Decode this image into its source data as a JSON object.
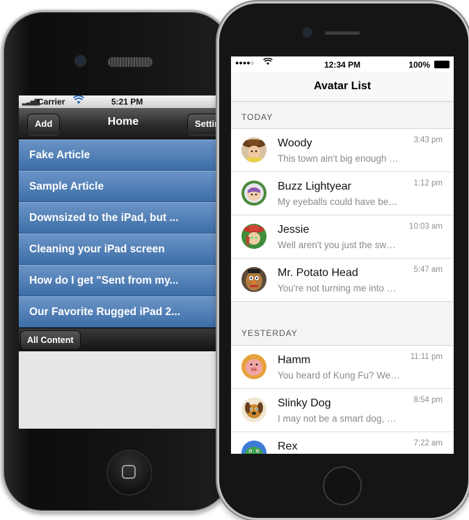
{
  "old_phone": {
    "status": {
      "carrier": "Carrier",
      "time": "5:21 PM"
    },
    "nav": {
      "left_button": "Add",
      "title": "Home",
      "right_button": "Settings"
    },
    "articles": [
      "Fake Article",
      "Sample Article",
      "Downsized to the iPad, but ...",
      "Cleaning your iPad screen",
      "How do I get \"Sent from my...",
      "Our Favorite Rugged iPad 2..."
    ],
    "toolbar": {
      "button": "All Content"
    }
  },
  "new_phone": {
    "status": {
      "time": "12:34 PM",
      "battery": "100%"
    },
    "nav": {
      "title": "Avatar List"
    },
    "sections": [
      {
        "header": "TODAY",
        "items": [
          {
            "name": "Woody",
            "message": "This town ain't big enough for the two of us",
            "time": "3:43 pm",
            "avatar_color": "#b5763a",
            "avatar_icon": "cowboy-avatar-icon"
          },
          {
            "name": "Buzz Lightyear",
            "message": "My eyeballs could have been sucked from their sockets",
            "time": "1:12 pm",
            "avatar_color": "#7a4fa8",
            "avatar_icon": "astronaut-avatar-icon"
          },
          {
            "name": "Jessie",
            "message": "Well aren't you just the sweetest",
            "time": "10:03 am",
            "avatar_color": "#c0392b",
            "avatar_icon": "cowgirl-avatar-icon"
          },
          {
            "name": "Mr. Potato Head",
            "message": "You're not turning me into a martian",
            "time": "5:47 am",
            "avatar_color": "#8e5a2a",
            "avatar_icon": "potato-avatar-icon"
          }
        ]
      },
      {
        "header": "YESTERDAY",
        "items": [
          {
            "name": "Hamm",
            "message": "You heard of Kung Fu? Well get ready",
            "time": "11:11 pm",
            "avatar_color": "#e89a9a",
            "avatar_icon": "pig-avatar-icon"
          },
          {
            "name": "Slinky Dog",
            "message": "I may not be a smart dog, but I know what roadkill is",
            "time": "8:54 pm",
            "avatar_color": "#c8872e",
            "avatar_icon": "dog-avatar-icon"
          },
          {
            "name": "Rex",
            "message": "",
            "time": "7:22 am",
            "avatar_color": "#3fa34d",
            "avatar_icon": "dinosaur-avatar-icon"
          }
        ]
      }
    ]
  }
}
